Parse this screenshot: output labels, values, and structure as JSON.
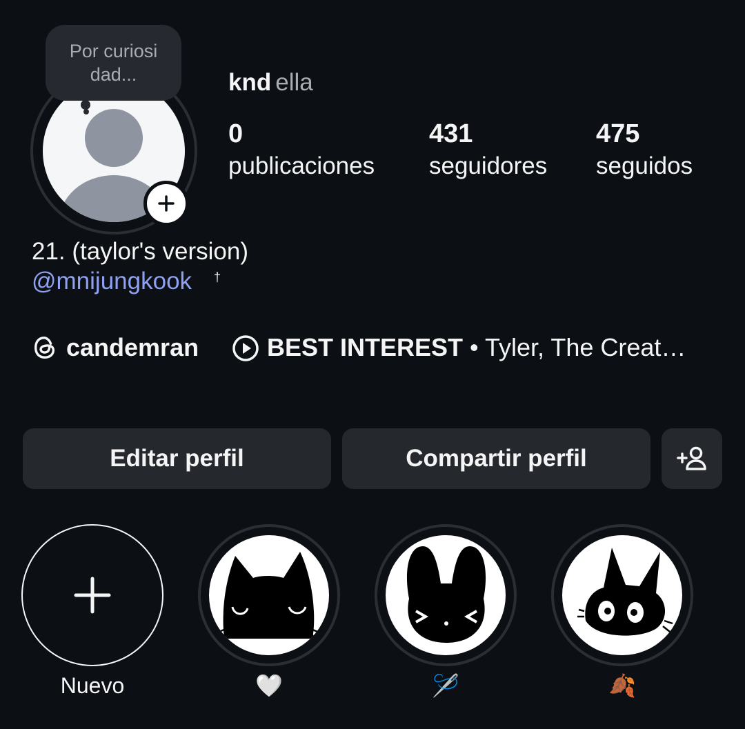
{
  "profile": {
    "note": "Por curiosi dad...",
    "username": "knd",
    "pronouns": "ella",
    "stats": [
      {
        "value": "0",
        "label": "publicaciones"
      },
      {
        "value": "431",
        "label": "seguidores"
      },
      {
        "value": "475",
        "label": "seguidos"
      }
    ],
    "bio_line": "21. (taylor's version)",
    "bio_mention": "@mnijungkook",
    "bio_mark": "†",
    "threads_handle": "candemran",
    "song_title": "BEST INTEREST",
    "song_artist": " • Tyler, The Creat…"
  },
  "buttons": {
    "edit": "Editar perfil",
    "share": "Compartir perfil"
  },
  "highlights": [
    {
      "label": "Nuevo"
    },
    {
      "label": "🤍"
    },
    {
      "label": "🪡"
    },
    {
      "label": "🍂"
    }
  ],
  "icons": {
    "add_story": "plus-icon",
    "threads": "threads-icon",
    "music": "play-circle-icon",
    "discover": "add-person-icon"
  }
}
